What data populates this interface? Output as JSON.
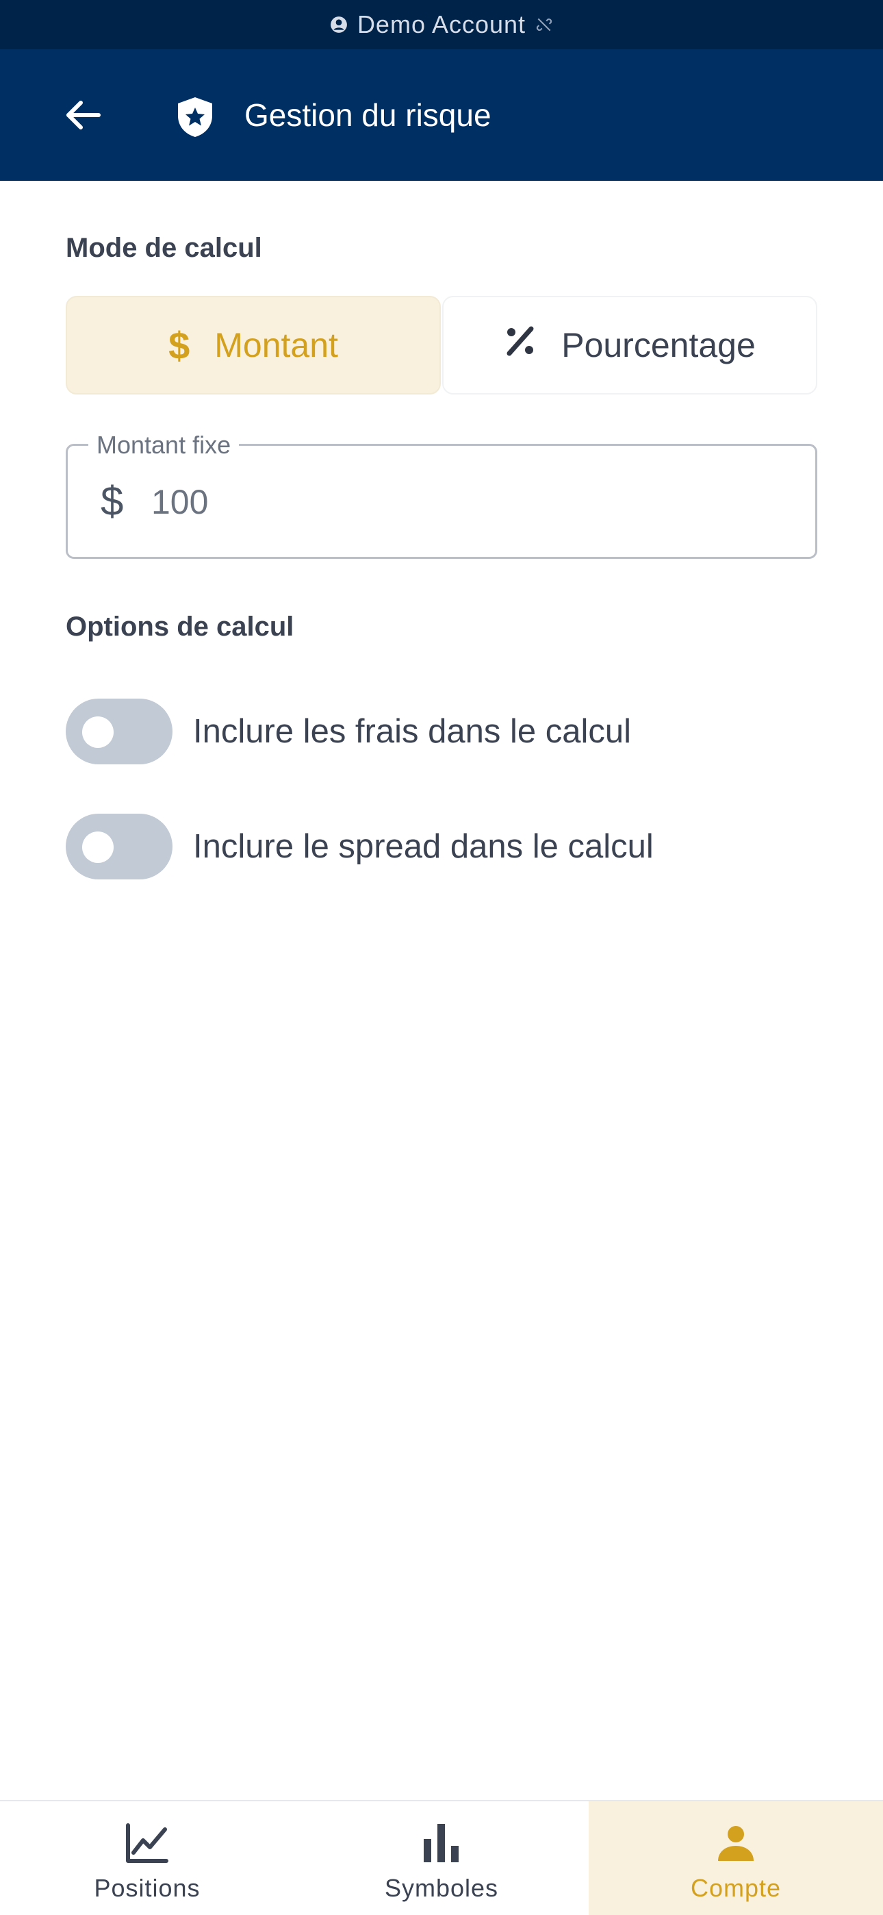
{
  "status_bar": {
    "text": "Demo Account"
  },
  "header": {
    "title": "Gestion du risque"
  },
  "calc_mode": {
    "label": "Mode de calcul",
    "options": [
      {
        "label": "Montant",
        "icon": "dollar-icon",
        "selected": true
      },
      {
        "label": "Pourcentage",
        "icon": "percent-icon",
        "selected": false
      }
    ]
  },
  "amount_field": {
    "label": "Montant fixe",
    "currency": "$",
    "value": "100"
  },
  "calc_options": {
    "label": "Options de calcul",
    "items": [
      {
        "label": "Inclure les frais dans le calcul",
        "enabled": false
      },
      {
        "label": "Inclure le spread dans le calcul",
        "enabled": false
      }
    ]
  },
  "bottom_nav": {
    "items": [
      {
        "label": "Positions",
        "icon": "line-chart-icon",
        "active": false
      },
      {
        "label": "Symboles",
        "icon": "bar-chart-icon",
        "active": false
      },
      {
        "label": "Compte",
        "icon": "person-icon",
        "active": true
      }
    ]
  },
  "colors": {
    "status_bar_bg": "#00234a",
    "app_bar_bg": "#002f63",
    "accent": "#d4a11e",
    "accent_bg": "#f9f0dd",
    "toggle_off": "#c2cad6"
  }
}
